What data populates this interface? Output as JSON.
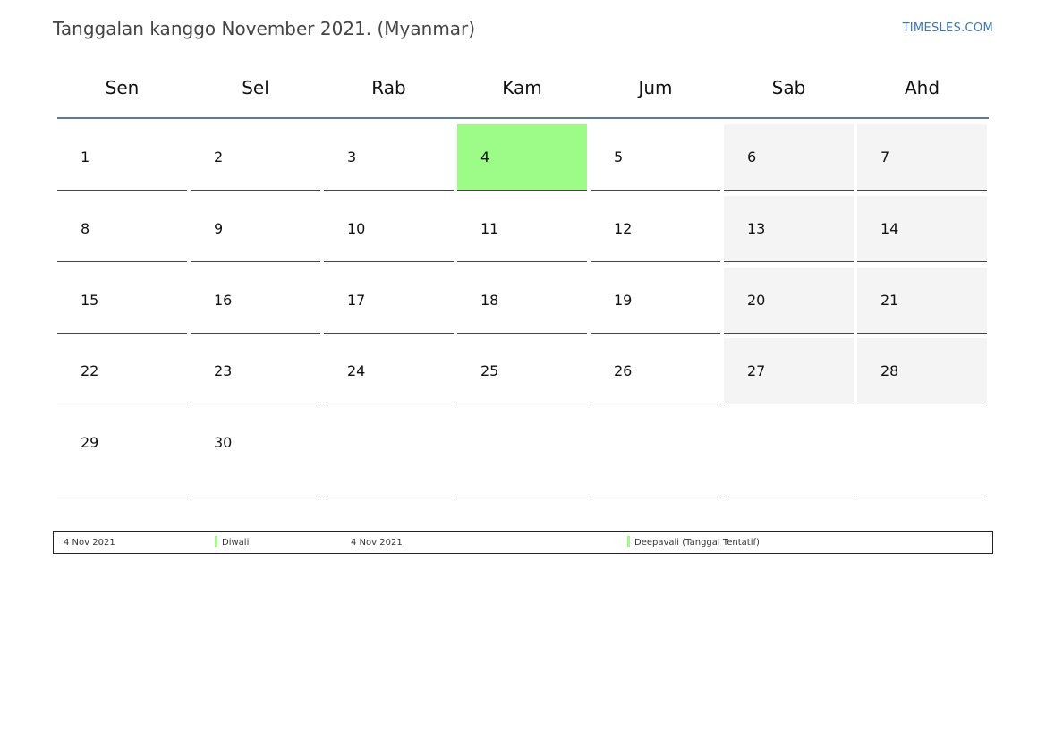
{
  "header": {
    "title": "Tanggalan kanggo November 2021. (Myanmar)",
    "brand": "TIMESLES.COM"
  },
  "colors": {
    "holiday": "#9dfb88",
    "weekend": "#f4f4f4",
    "header_line": "#5d7a9b",
    "brand": "#3a78b5"
  },
  "calendar": {
    "weekdays": [
      "Sen",
      "Sel",
      "Rab",
      "Kam",
      "Jum",
      "Sab",
      "Ahd"
    ],
    "weeks": [
      [
        "1",
        "2",
        "3",
        "4",
        "5",
        "6",
        "7"
      ],
      [
        "8",
        "9",
        "10",
        "11",
        "12",
        "13",
        "14"
      ],
      [
        "15",
        "16",
        "17",
        "18",
        "19",
        "20",
        "21"
      ],
      [
        "22",
        "23",
        "24",
        "25",
        "26",
        "27",
        "28"
      ],
      [
        "29",
        "30",
        "",
        "",
        "",
        "",
        ""
      ]
    ],
    "highlighted_day": "4"
  },
  "legend": [
    {
      "date": "4 Nov 2021",
      "name": "Diwali"
    },
    {
      "date": "4 Nov 2021",
      "name": "Deepavali (Tanggal Tentatif)"
    }
  ]
}
